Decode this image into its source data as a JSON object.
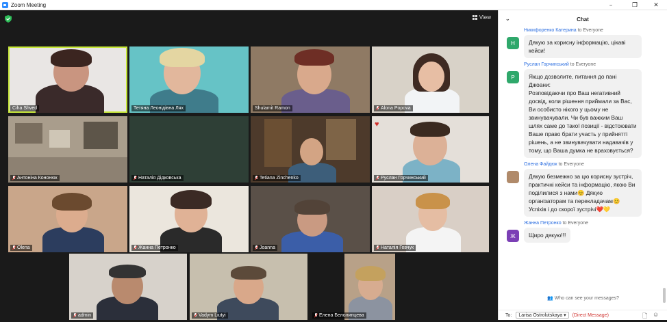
{
  "window": {
    "title": "Zoom Meeting"
  },
  "toolbar": {
    "view_label": "View"
  },
  "participants": [
    {
      "name": "Ciha Shved",
      "muted": false
    },
    {
      "name": "Тетяна Леонідівна Лях",
      "muted": false
    },
    {
      "name": "Shulamit Ramon",
      "muted": false
    },
    {
      "name": "Alona Popova",
      "muted": true
    },
    {
      "name": "Антоніна Кононюк",
      "muted": true
    },
    {
      "name": "Наталія Дідковська",
      "muted": true
    },
    {
      "name": "Tetiana Zinchenko",
      "muted": true
    },
    {
      "name": "Руслан Горчинський",
      "muted": true
    },
    {
      "name": "Olena",
      "muted": true
    },
    {
      "name": "Жанна Петронко",
      "muted": true
    },
    {
      "name": "Joanna",
      "muted": true
    },
    {
      "name": "Наталія Гевчук",
      "muted": true
    },
    {
      "name": "admin",
      "muted": true
    },
    {
      "name": "Vadym Liutyi",
      "muted": true
    },
    {
      "name": "Елена Белолипцева",
      "muted": true
    }
  ],
  "chat": {
    "title": "Chat",
    "messages": [
      {
        "sender": "Никифоренко Катерина",
        "to": "to Everyone",
        "initial": "Н",
        "color": "#2fa86b",
        "text": "Дякую за корисну інформацію, цікаві кейси!"
      },
      {
        "sender": "Руслан Горчинський",
        "to": "to Everyone",
        "initial": "Р",
        "color": "#2fa86b",
        "text": "Якщо дозволите, питання до пані Джоани:\nРозповідаючи про Ваш негативний досвід, коли рішення приймали за Вас, Ви особисто нікого у цьому не звинувачували. Чи був важким Ваш шлях саме до такої позиції - відстоювати Ваше право брати участь у прийнятті рішень, а не звинувачувати надавачів у тому, що Ваша думка не враховується?"
      },
      {
        "sender": "Олена Файдюк",
        "to": "to Everyone",
        "initial": "",
        "color": "#b08a6a",
        "text": "Дякую безмежно за цю корисну зустріч, практичні кейси та інформацію, якою Ви поділилися з нами😊 Дякую організаторам та перекладачам😊 Успіхів і до скорої зустрічі❤️💛"
      },
      {
        "sender": "Жанна Петронко",
        "to": "to Everyone",
        "initial": "Ж",
        "color": "#7b3fb5",
        "text": "Щиро дякую!!!"
      }
    ],
    "who_can_see": "Who can see your messages?",
    "to_label": "To:",
    "recipient": "Larisa Ostrolutskaya",
    "direct_message": "(Direct Message)"
  },
  "icons": [
    "zoom-app-icon",
    "shield-icon",
    "grid-view-icon",
    "chevron-down-icon",
    "mic-muted-icon",
    "file-icon",
    "emoji-icon"
  ]
}
